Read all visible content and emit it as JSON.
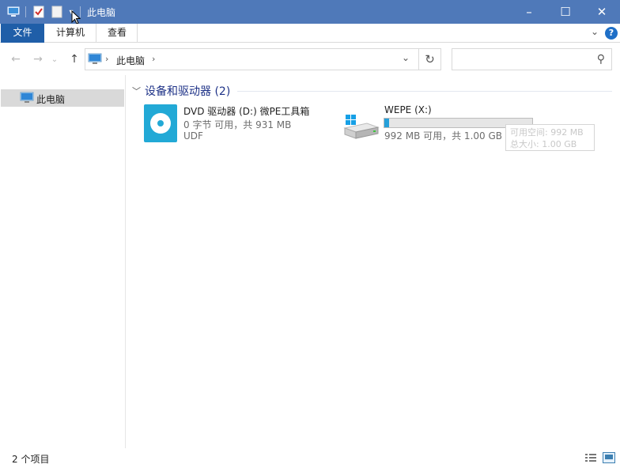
{
  "window": {
    "title": "此电脑",
    "controls": {
      "minimize": "–",
      "maximize": "☐",
      "close": "✕"
    }
  },
  "ribbon": {
    "tabs": [
      "文件",
      "计算机",
      "查看"
    ],
    "help": "?"
  },
  "nav": {
    "back_icon": "arrow-left-icon",
    "forward_icon": "arrow-right-icon",
    "up_icon": "arrow-up-icon",
    "breadcrumb": [
      "此电脑"
    ],
    "search_placeholder": ""
  },
  "sidebar": {
    "items": [
      {
        "label": "此电脑",
        "selected": true
      }
    ]
  },
  "main": {
    "group_title": "设备和驱动器 (2)",
    "drives": [
      {
        "name": "DVD 驱动器 (D:) 微PE工具箱",
        "detail": "0 字节 可用，共 931 MB",
        "fs": "UDF",
        "icon": "dvd-drive-icon"
      },
      {
        "name": "WEPE (X:)",
        "detail": "992 MB 可用，共 1.00 GB",
        "used_fraction": 0.008,
        "icon": "windows-drive-icon"
      }
    ],
    "tooltip": {
      "line1": "可用空间: 992 MB",
      "line2": "总大小: 1.00 GB"
    }
  },
  "status": {
    "item_count": "2 个项目"
  },
  "colors": {
    "titlebar": "#4f79b9",
    "file_tab": "#1f5ea8",
    "accent": "#26a0da",
    "group_title": "#1e3287"
  }
}
